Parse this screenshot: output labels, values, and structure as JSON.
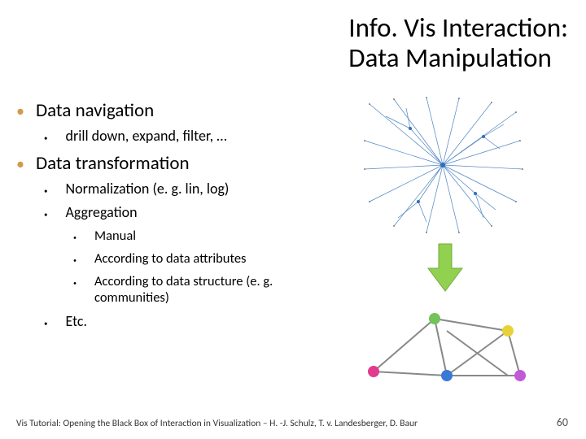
{
  "title_line1": "Info. Vis Interaction:",
  "title_line2": "Data Manipulation",
  "bullets": {
    "b1": "Data navigation",
    "b1_1": "drill down, expand, filter, …",
    "b2": "Data transformation",
    "b2_1": "Normalization (e. g. lin, log)",
    "b2_2": "Aggregation",
    "b2_2_1": "Manual",
    "b2_2_2": "According to data attributes",
    "b2_2_3": "According to data structure (e. g. communities)",
    "b2_3": "Etc."
  },
  "footer": "Vis Tutorial: Opening the Black Box of Interaction in Visualization – H. -J. Schulz, T. v. Landesberger, D. Baur",
  "page_number": "60",
  "colors": {
    "bullet_accent": "#D39A4A",
    "arrow_fill": "#92D050"
  }
}
